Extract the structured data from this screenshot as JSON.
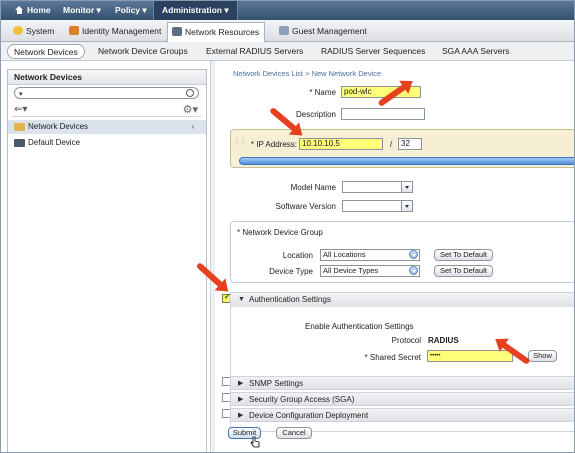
{
  "topnav": {
    "home": "Home",
    "monitor": "Monitor ▾",
    "policy": "Policy ▾",
    "administration": "Administration ▾"
  },
  "subnav": {
    "system": "System",
    "identity": "Identity Management",
    "network_resources": "Network Resources",
    "guest": "Guest Management"
  },
  "thirdnav": {
    "network_devices": "Network Devices",
    "network_device_groups": "Network Device Groups",
    "external_radius": "External RADIUS Servers",
    "radius_sequences": "RADIUS Server Sequences",
    "sga_aaa": "SGA AAA Servers"
  },
  "sidebar": {
    "title": "Network Devices",
    "search_value": "",
    "items": [
      {
        "label": "Network Devices",
        "selected": true
      },
      {
        "label": "Default Device",
        "selected": false
      }
    ]
  },
  "form": {
    "breadcrumb": "Network Devices List > New Network Device",
    "name_label": "* Name",
    "name_value": "pod-wlc",
    "description_label": "Description",
    "description_value": "",
    "ip_label": "* IP Address:",
    "ip_value": "10.10.10.5",
    "mask_sep": "/",
    "mask_value": "32",
    "model_label": "Model Name",
    "model_value": "",
    "software_label": "Software Version",
    "software_value": "",
    "ndg_title": "* Network Device Group",
    "location_label": "Location",
    "location_value": "All Locations",
    "device_type_label": "Device Type",
    "device_type_value": "All Device Types",
    "set_default": "Set To Default",
    "auth_title": "Authentication Settings",
    "auth_checked": true,
    "enable_auth": "Enable Authentication Settings",
    "protocol_label": "Protocol",
    "protocol_value": "RADIUS",
    "secret_label": "* Shared Secret",
    "secret_value": "•••••",
    "show": "Show",
    "snmp": "SNMP Settings",
    "sga": "Security Group Access (SGA)",
    "deploy": "Device Configuration Deployment",
    "submit": "Submit",
    "cancel": "Cancel"
  },
  "colors": {
    "nav_bg": "#36506f",
    "highlight": "#ffff7a",
    "arrow": "#e6401f",
    "ip_panel": "#f6efd3",
    "progress": "#4c8fde"
  }
}
